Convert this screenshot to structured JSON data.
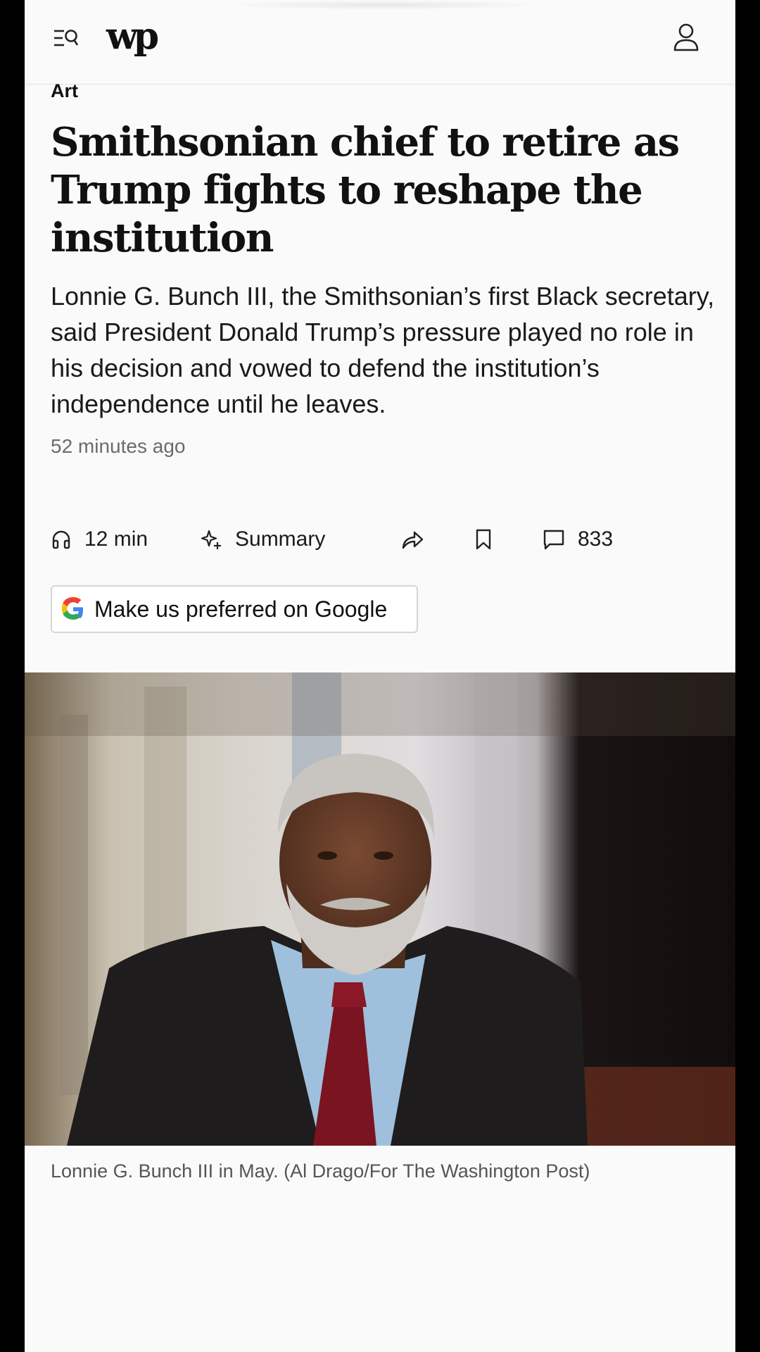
{
  "header": {
    "logo_text": "wp",
    "menu_icon": "menu-search-icon",
    "account_icon": "person-icon"
  },
  "article": {
    "kicker": "Art",
    "headline": "Smithsonian chief to retire as Trump fights to reshape the institution",
    "dek": "Lonnie G. Bunch III, the Smithsonian’s first Black secretary, said President Donald Trump’s pressure played no role in his decision and vowed to defend the institution’s independence until he leaves.",
    "timestamp": "52 minutes ago"
  },
  "toolbar": {
    "listen_label": "12 min",
    "listen_icon": "headphones-icon",
    "summary_label": "Summary",
    "summary_icon": "sparkle-icon",
    "share_icon": "share-arrow-icon",
    "bookmark_icon": "bookmark-icon",
    "comments_count": "833",
    "comments_icon": "comment-icon"
  },
  "google_button": {
    "label": "Make us preferred on Google",
    "icon": "google-g-icon"
  },
  "photo": {
    "caption": "Lonnie G. Bunch III in May. (Al Drago/For The Washington Post)"
  },
  "colors": {
    "page_background": "#fafafa",
    "text": "#111111",
    "muted_text": "#6b6b6b",
    "divider": "#e2e2e2"
  }
}
